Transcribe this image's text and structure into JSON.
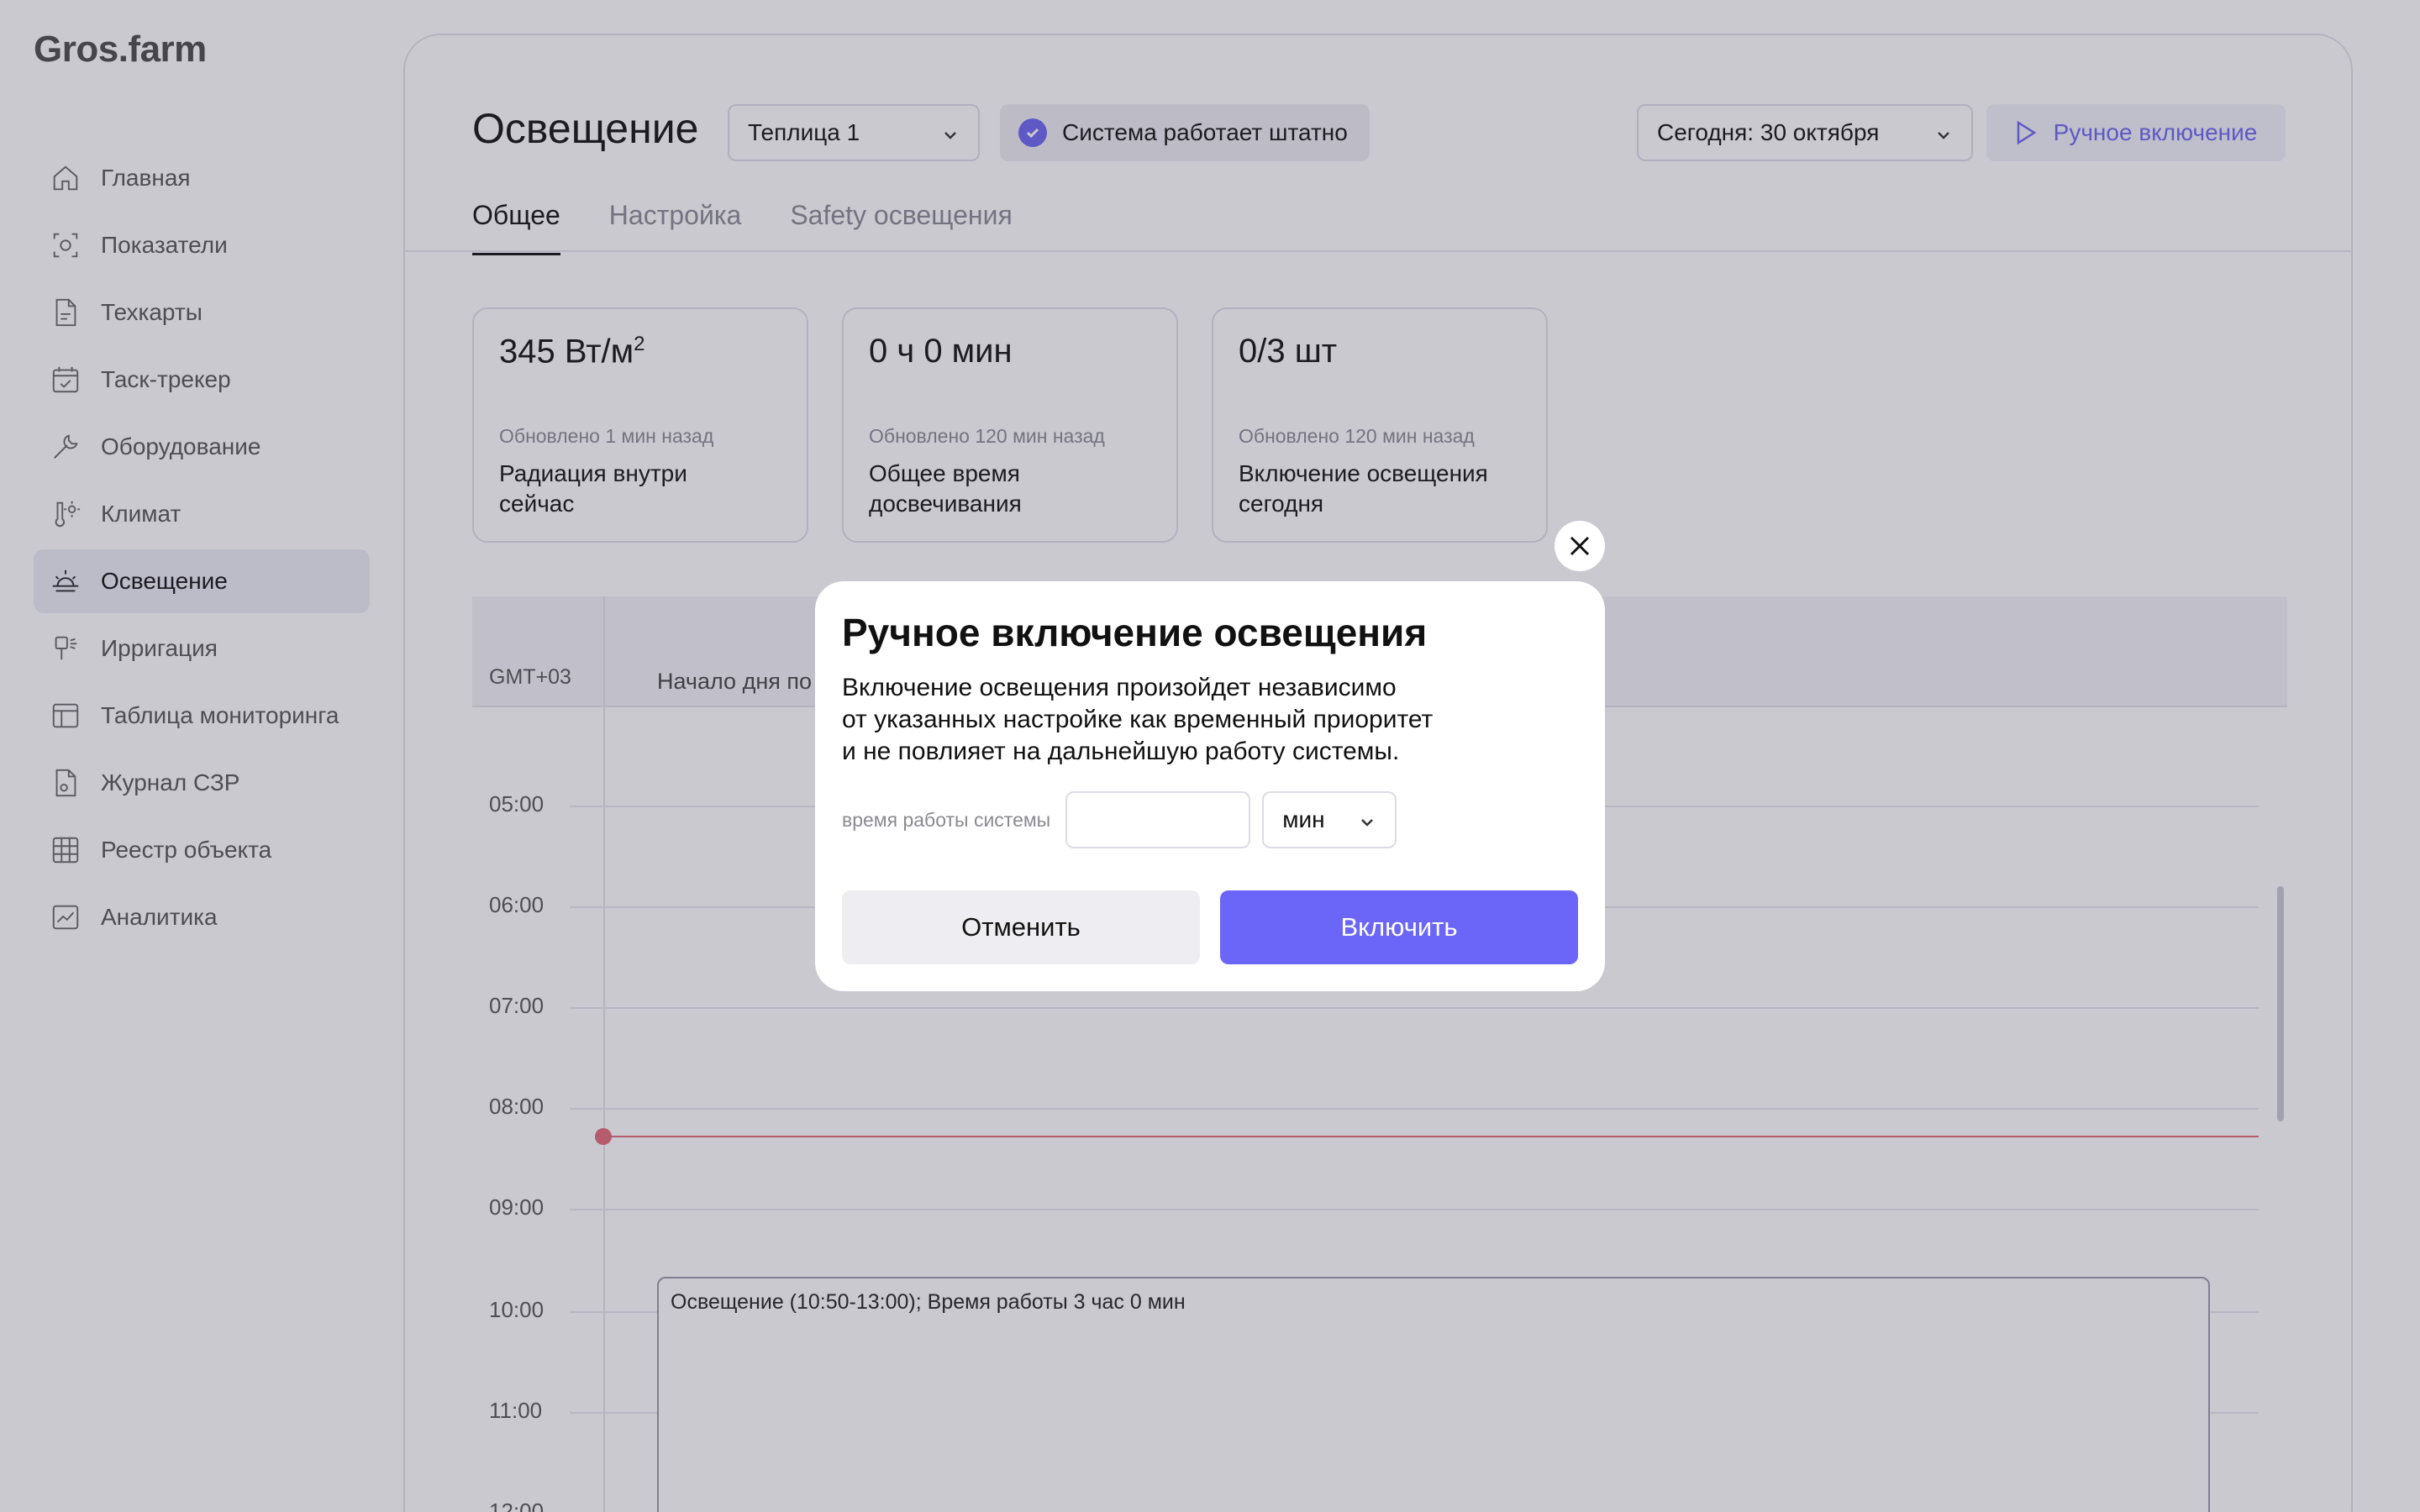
{
  "brand": {
    "logo": "Gros.farm"
  },
  "sidebar": {
    "items": [
      {
        "label": "Главная",
        "icon": "home-icon"
      },
      {
        "label": "Показатели",
        "icon": "indicators-icon"
      },
      {
        "label": "Техкарты",
        "icon": "document-icon"
      },
      {
        "label": "Таск-трекер",
        "icon": "calendar-check-icon"
      },
      {
        "label": "Оборудование",
        "icon": "wrench-icon"
      },
      {
        "label": "Климат",
        "icon": "thermometer-sun-icon"
      },
      {
        "label": "Освещение",
        "icon": "sunrise-icon",
        "active": true
      },
      {
        "label": "Ирригация",
        "icon": "sprinkler-icon"
      },
      {
        "label": "Таблица мониторинга",
        "icon": "table-icon"
      },
      {
        "label": "Журнал СЗР",
        "icon": "journal-icon"
      },
      {
        "label": "Реестр объекта",
        "icon": "grid-icon"
      },
      {
        "label": "Аналитика",
        "icon": "chart-icon"
      }
    ]
  },
  "header": {
    "title": "Освещение",
    "greenhouse_select": "Теплица 1",
    "status": "Система работает штатно",
    "date_select": "Сегодня: 30 октября",
    "manual_button": "Ручное включение"
  },
  "tabs": [
    {
      "label": "Общее",
      "active": true
    },
    {
      "label": "Настройка"
    },
    {
      "label": "Safety освещения"
    }
  ],
  "cards": [
    {
      "value": "345 Вт/м",
      "sup": "2",
      "updated": "Обновлено 1 мин назад",
      "label": "Радиация внутри сейчас"
    },
    {
      "value": "0 ч 0 мин",
      "updated": "Обновлено 120 мин назад",
      "label": "Общее время досвечивания"
    },
    {
      "value": "0/3 шт",
      "updated": "Обновлено 120 мин назад",
      "label": "Включение освещения сегодня"
    }
  ],
  "schedule": {
    "timezone": "GMT+03",
    "day_start_label": "Начало дня по",
    "times": [
      "05:00",
      "06:00",
      "07:00",
      "08:00",
      "09:00",
      "10:00",
      "11:00",
      "12:00"
    ],
    "event": "Освещение (10:50-13:00); Время работы 3 час 0 мин"
  },
  "modal": {
    "title": "Ручное включение освещения",
    "text_line1": "Включение освещения произойдет независимо",
    "text_line2": "от указанных настройке как временный приоритет",
    "text_line3": "и не повлияет на дальнейшую работу системы.",
    "field_label": "время работы системы",
    "field_value": "",
    "unit": "мин",
    "cancel": "Отменить",
    "confirm": "Включить"
  },
  "colors": {
    "accent": "#6b66f8",
    "now_line": "#e26a78"
  }
}
